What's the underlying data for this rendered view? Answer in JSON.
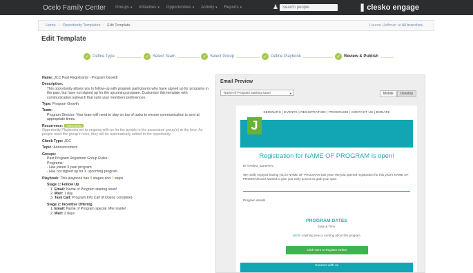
{
  "nav": {
    "brand": "Ocelo Family Center",
    "items": [
      "Groups",
      "Initiatives",
      "Opportunities",
      "Activity",
      "Reports"
    ],
    "search_placeholder": "Search people",
    "logo_text": "clesko engage"
  },
  "breadcrumb": {
    "home": "Home",
    "sep": "›",
    "parent": "Opportunity Templates",
    "current": "Edit Template",
    "logged_in_prefix": "Lauren Hoffman at",
    "logged_in_org": "All branches"
  },
  "page_title": "Edit Template",
  "steps": [
    {
      "label": "Define Type"
    },
    {
      "label": "Select Team"
    },
    {
      "label": "Select Group"
    },
    {
      "label": "Define Playbook"
    },
    {
      "label": "Review & Publish"
    }
  ],
  "summary": {
    "name_label": "Name:",
    "name_value": "JCC Past Registrants - Program Growth",
    "description_label": "Description:",
    "description_value": "This opportunity allows you to follow-up with program participants who have signed up for programs in the past, but have not signed up for the upcoming program. Customize this template with communication outreach that suits your members preferences.",
    "type_label": "Type:",
    "type_value": "Program Growth",
    "team_label": "Team:",
    "team_value": "Program Director: Your team will need to stay on top of tasks to ensure communication is sent at appropriate times.",
    "recurrence_label": "Recurrence:",
    "recurrence_badge": "ONGOING",
    "recurrence_value": "Opportunity Playbooks set to ongoing will run for the people in the associated group(s) at the time. As people meet the group's rules, they will be automatically added to the opportunity.",
    "check_type_label": "Check Type:",
    "check_type_value": "JCC",
    "topic_label": "Topic:",
    "topic_value": "Announcement",
    "groups_label": "Groups:",
    "groups_lines": [
      "Past Program Registrant Group Rules:",
      "Programs:",
      "- Has joined X past program",
      "- Has not signed up for X upcoming program"
    ],
    "playbook_label": "Playbook:",
    "playbook_prefix": "This playbook has",
    "playbook_stages": "6",
    "playbook_mid": "stages and",
    "playbook_steps": "7",
    "playbook_suffix": "steps",
    "stage1_title": "Stage 1: Follow Up",
    "stage1_items": [
      {
        "label": "Email:",
        "value": "Name of Program starting soon!"
      },
      {
        "label": "Wait:",
        "value": "1 day"
      },
      {
        "label": "Task Call:",
        "value": "Program Info Call (if Opens complete)"
      }
    ],
    "stage2_title": "Stage 2: Incentive Offering",
    "stage2_items": [
      {
        "label": "Email:",
        "value": "Name of Program special offer inside!"
      },
      {
        "label": "Wait:",
        "value": "2 days"
      }
    ]
  },
  "email_preview": {
    "title": "Email Preview",
    "selected_email": "Name of Program starting soon!",
    "toggle": [
      "Mobile",
      "Desktop"
    ],
    "email_nav": "SEMINARS | EVENTS | REGISTRATION | PROGRAMS | CONTACT US | DONATE",
    "logo_letter": "J",
    "headline": "Registration for NAME OF PROGRAM is open!",
    "greeting": "Hi %%first_name%%,",
    "body": "We really enjoyed having you in NAME OF PROGRAM last year! We just opened registration for this year's NAME OF PROGRAM and wanted to give you early access to grab your spot.",
    "details_label": "Program details",
    "dates_heading": "PROGRAM DATES",
    "dates_sub": "Date & Time",
    "note_new": "NEW!",
    "note_text": "Anything new or exciting about this program",
    "cta": "Click Here to Register Online",
    "footer": "Connect with us"
  },
  "colors": {
    "topbar": "#2b2d2f",
    "step_check": "#a7c84d",
    "email_teal": "#12a5b3",
    "email_green": "#3fb34f",
    "logo_green": "#63b335"
  },
  "icons": [
    "user-icon",
    "clesko-logo-mark-icon",
    "check-icon",
    "chevron-down-icon"
  ]
}
